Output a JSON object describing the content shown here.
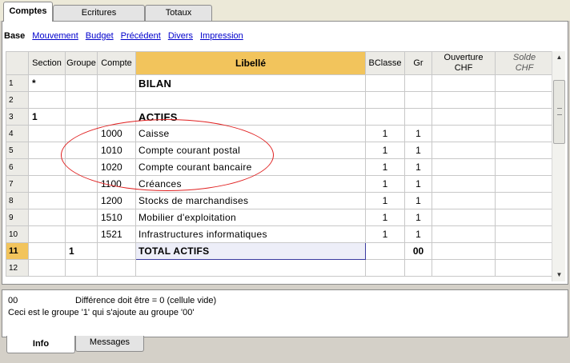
{
  "top_tabs": [
    {
      "label": "Comptes"
    },
    {
      "label": "Ecritures"
    },
    {
      "label": "Totaux"
    }
  ],
  "subnav": {
    "active": "Base",
    "links": [
      "Mouvement",
      "Budget",
      "Précédent",
      "Divers",
      "Impression"
    ]
  },
  "table": {
    "headers": {
      "section": "Section",
      "groupe": "Groupe",
      "compte": "Compte",
      "libelle": "Libellé",
      "bclasse": "BClasse",
      "gr": "Gr",
      "ouverture_1": "Ouverture",
      "ouverture_2": "CHF",
      "solde_1": "Solde",
      "solde_2": "CHF"
    },
    "rows": [
      {
        "n": "1",
        "section": "*",
        "groupe": "",
        "compte": "",
        "libelle": "BILAN",
        "bclasse": "",
        "gr": ""
      },
      {
        "n": "2",
        "section": "",
        "groupe": "",
        "compte": "",
        "libelle": "",
        "bclasse": "",
        "gr": ""
      },
      {
        "n": "3",
        "section": "1",
        "groupe": "",
        "compte": "",
        "libelle": "ACTIFS",
        "bclasse": "",
        "gr": ""
      },
      {
        "n": "4",
        "section": "",
        "groupe": "",
        "compte": "1000",
        "libelle": "Caisse",
        "bclasse": "1",
        "gr": "1"
      },
      {
        "n": "5",
        "section": "",
        "groupe": "",
        "compte": "1010",
        "libelle": "Compte courant postal",
        "bclasse": "1",
        "gr": "1"
      },
      {
        "n": "6",
        "section": "",
        "groupe": "",
        "compte": "1020",
        "libelle": "Compte courant bancaire",
        "bclasse": "1",
        "gr": "1"
      },
      {
        "n": "7",
        "section": "",
        "groupe": "",
        "compte": "1100",
        "libelle": "Créances",
        "bclasse": "1",
        "gr": "1"
      },
      {
        "n": "8",
        "section": "",
        "groupe": "",
        "compte": "1200",
        "libelle": "Stocks de marchandises",
        "bclasse": "1",
        "gr": "1"
      },
      {
        "n": "9",
        "section": "",
        "groupe": "",
        "compte": "1510",
        "libelle": "Mobilier d'exploitation",
        "bclasse": "1",
        "gr": "1"
      },
      {
        "n": "10",
        "section": "",
        "groupe": "",
        "compte": "1521",
        "libelle": "Infrastructures informatiques",
        "bclasse": "1",
        "gr": "1"
      },
      {
        "n": "11",
        "section": "",
        "groupe": "1",
        "compte": "",
        "libelle": "TOTAL ACTIFS",
        "bclasse": "",
        "gr": "00"
      },
      {
        "n": "12",
        "section": "",
        "groupe": "",
        "compte": "",
        "libelle": "",
        "bclasse": "",
        "gr": ""
      }
    ]
  },
  "info": {
    "line1_code": "00",
    "line1_text": "Différence doit être = 0 (cellule vide)",
    "line2_text": "Ceci est le groupe '1' qui s'ajoute au groupe '00'"
  },
  "bottom_tabs": [
    {
      "label": "Info"
    },
    {
      "label": "Messages"
    }
  ],
  "colors": {
    "header_highlight": "#f2c45c",
    "annotation": "#e02020",
    "link": "#0000cc"
  }
}
